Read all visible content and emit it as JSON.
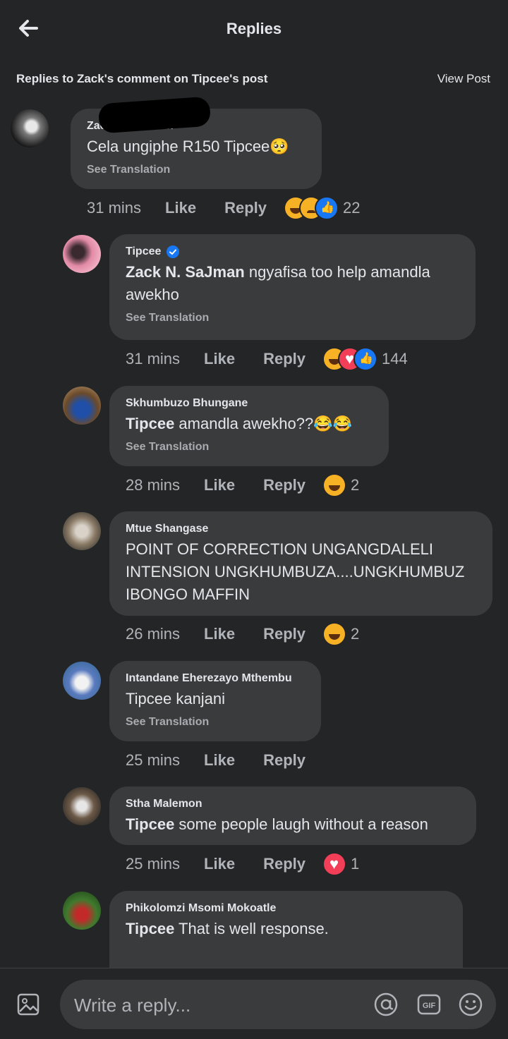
{
  "header": {
    "title": "Replies"
  },
  "subheader": {
    "context": "Replies to Zack's comment on Tipcee's post",
    "view_post": "View Post"
  },
  "comments": [
    {
      "author": "Zack N. SaJman",
      "text": "Cela ungiphe R150 Tipcee🥺",
      "see_translation": "See Translation",
      "time": "31 mins",
      "like": "Like",
      "reply": "Reply",
      "reactions": [
        "haha",
        "sad",
        "like"
      ],
      "reaction_count": "22"
    },
    {
      "author": "Tipcee",
      "verified": true,
      "mention": "Zack N. SaJman",
      "text": " ngyafisa too help amandla awekho",
      "see_translation": "See Translation",
      "time": "31 mins",
      "like": "Like",
      "reply": "Reply",
      "reactions": [
        "haha",
        "love",
        "like"
      ],
      "reaction_count": "144"
    },
    {
      "author": "Skhumbuzo Bhungane",
      "mention": "Tipcee",
      "text": " amandla awekho??😂😂",
      "see_translation": "See Translation",
      "time": "28 mins",
      "like": "Like",
      "reply": "Reply",
      "reactions": [
        "haha"
      ],
      "reaction_count": "2"
    },
    {
      "author": "Mtue Shangase",
      "text": "POINT OF CORRECTION UNGANGDALELI INTENSION UNGKHUMBUZA....UNGKHUMBUZ IBONGO MAFFIN",
      "time": "26 mins",
      "like": "Like",
      "reply": "Reply",
      "reactions": [
        "haha"
      ],
      "reaction_count": "2"
    },
    {
      "author": "Intandane Eherezayo Mthembu",
      "text": "Tipcee kanjani",
      "see_translation": "See Translation",
      "time": "25 mins",
      "like": "Like",
      "reply": "Reply"
    },
    {
      "author": "Stha Malemon",
      "mention": "Tipcee",
      "text": " some people laugh without a reason",
      "time": "25 mins",
      "like": "Like",
      "reply": "Reply",
      "reactions": [
        "love"
      ],
      "reaction_count": "1"
    },
    {
      "author": "Phikolomzi Msomi Mokoatle",
      "mention": "Tipcee",
      "text": " That is well response."
    }
  ],
  "composer": {
    "placeholder": "Write a reply...",
    "icons": [
      "photo-icon",
      "at-mention-icon",
      "gif-icon",
      "emoji-icon"
    ]
  },
  "colors": {
    "background": "#242526",
    "bubble": "#3a3b3c",
    "verified": "#1877f2"
  }
}
